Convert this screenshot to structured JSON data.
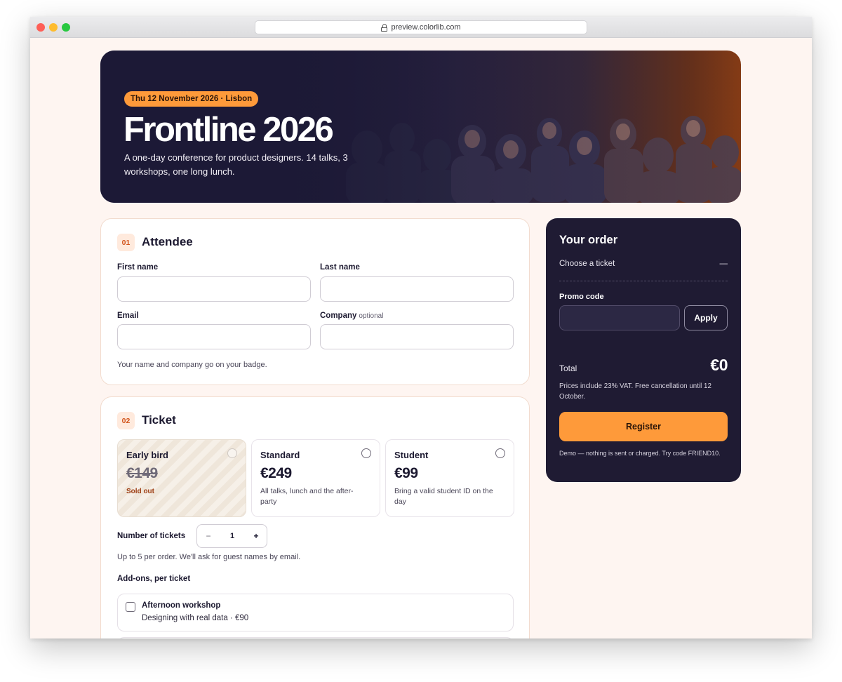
{
  "browser": {
    "url": "preview.colorlib.com"
  },
  "hero": {
    "date_badge": "Thu 12 November 2026 · Lisbon",
    "title": "Frontline 2026",
    "subtitle": "A one-day conference for product designers. 14 talks, 3 workshops, one long lunch."
  },
  "attendee": {
    "step": "01",
    "title": "Attendee",
    "first_name_label": "First name",
    "last_name_label": "Last name",
    "email_label": "Email",
    "company_label": "Company",
    "company_optional": "optional",
    "first_name_value": "",
    "last_name_value": "",
    "email_value": "",
    "company_value": "",
    "helper": "Your name and company go on your badge."
  },
  "ticket": {
    "step": "02",
    "title": "Ticket",
    "options": [
      {
        "name": "Early bird",
        "price": "€149",
        "status": "Sold out",
        "sold_out": true,
        "selected": false
      },
      {
        "name": "Standard",
        "price": "€249",
        "desc": "All talks, lunch and the after-party",
        "selected": false
      },
      {
        "name": "Student",
        "price": "€99",
        "desc": "Bring a valid student ID on the day",
        "selected": false
      }
    ],
    "quantity_label": "Number of tickets",
    "quantity_minus": "−",
    "quantity_value": "1",
    "quantity_plus": "+",
    "quantity_helper": "Up to 5 per order. We'll ask for guest names by email.",
    "addons_title": "Add-ons, per ticket",
    "addons": [
      {
        "name": "Afternoon workshop",
        "desc": "Designing with real data · €90",
        "checked": false
      }
    ]
  },
  "order": {
    "title": "Your order",
    "line_label": "Choose a ticket",
    "line_value": "—",
    "promo_label": "Promo code",
    "promo_value": "",
    "apply_label": "Apply",
    "total_label": "Total",
    "total_value": "€0",
    "vat_note": "Prices include 23% VAT. Free cancellation until 12 October.",
    "register_label": "Register",
    "demo_note": "Demo — nothing is sent or charged. Try code FRIEND10."
  },
  "colors": {
    "accent": "#fe9a3a",
    "dark_panel": "#1f1b33",
    "page_bg": "#fef5f1"
  }
}
